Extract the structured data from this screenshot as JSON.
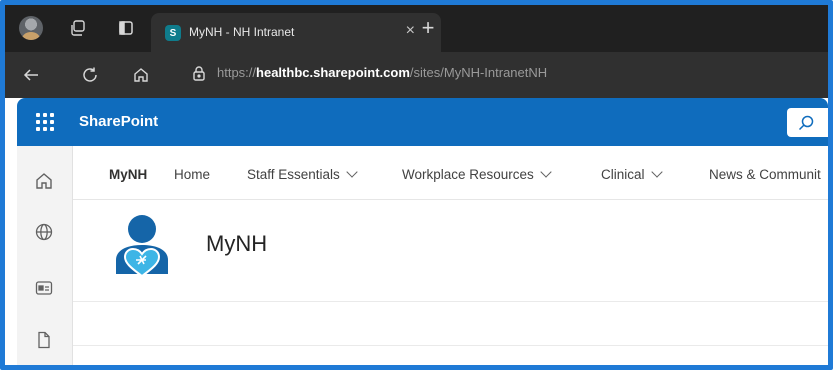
{
  "browser": {
    "tab": {
      "title": "MyNH - NH Intranet",
      "favicon_letter": "S",
      "close_glyph": "×"
    },
    "new_tab_glyph": "+",
    "url": {
      "scheme": "https://",
      "host": "healthbc.sharepoint.com",
      "path": "/sites/MyNH-IntranetNH"
    },
    "icons": [
      "profile-avatar",
      "workspaces-icon",
      "tab-actions-icon",
      "back-icon",
      "refresh-icon",
      "home-icon",
      "lock-icon"
    ]
  },
  "suite": {
    "title": "SharePoint",
    "accent": "#0f6cbd",
    "icons": [
      "app-launcher-icon",
      "search-icon"
    ]
  },
  "appbar": {
    "icons": [
      "home-icon",
      "globe-icon",
      "news-icon",
      "document-icon"
    ]
  },
  "sitenav": {
    "site_name": "MyNH",
    "items": [
      {
        "label": "Home"
      },
      {
        "label": "Staff Essentials"
      },
      {
        "label": "Workplace Resources"
      },
      {
        "label": "Clinical"
      },
      {
        "label": "News & Communit"
      }
    ]
  },
  "site": {
    "title": "MyNH",
    "logo_color": "#1565a8"
  },
  "colors": {
    "frame": "#1f7ad6",
    "browser_dark": "#202020"
  }
}
